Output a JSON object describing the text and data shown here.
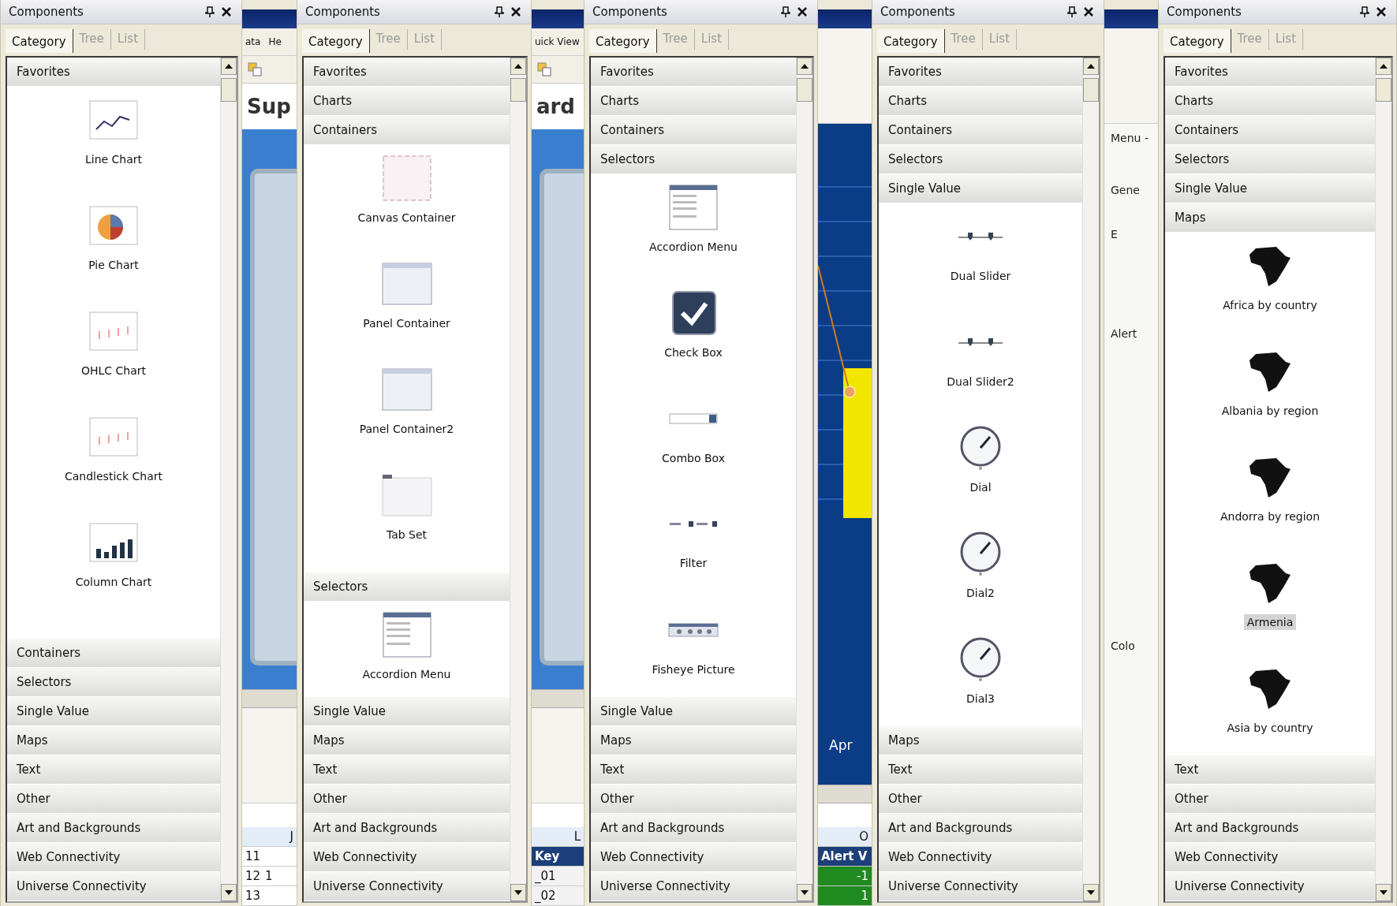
{
  "background_window": {
    "strips": [
      {
        "segments": [
          {
            "kind": "titlebar"
          },
          {
            "kind": "menubar",
            "texts": [
              "ata",
              "He"
            ]
          },
          {
            "kind": "toolbar"
          },
          {
            "kind": "heading",
            "text": "Sup"
          },
          {
            "kind": "canvas"
          },
          {
            "kind": "scrollbar"
          },
          {
            "kind": "blank"
          },
          {
            "kind": "sheet",
            "rows": [
              {
                "kind": "letter",
                "cells": [
                  "J"
                ]
              },
              {
                "kind": "number",
                "cells": [
                  "11"
                ]
              },
              {
                "kind": "number",
                "cells": [
                  "12",
                  "1"
                ]
              },
              {
                "kind": "number",
                "cells": [
                  "13"
                ]
              }
            ]
          }
        ]
      },
      {
        "segments": [
          {
            "kind": "titlebar"
          },
          {
            "kind": "menubar",
            "texts": [
              "uick View"
            ]
          },
          {
            "kind": "toolbar"
          },
          {
            "kind": "heading",
            "text": "ard"
          },
          {
            "kind": "canvas"
          },
          {
            "kind": "scrollbar"
          },
          {
            "kind": "blank"
          },
          {
            "kind": "sheet",
            "rows": [
              {
                "kind": "letter",
                "cells": [
                  "L"
                ]
              },
              {
                "kind": "header",
                "cells": [
                  "Key"
                ]
              },
              {
                "kind": "value",
                "cells": [
                  "_01"
                ]
              },
              {
                "kind": "value",
                "cells": [
                  "_02"
                ]
              }
            ]
          }
        ]
      },
      {
        "segments": [
          {
            "kind": "titlebar"
          },
          {
            "kind": "blank"
          },
          {
            "kind": "chart",
            "text": "Apr"
          },
          {
            "kind": "scrollbar"
          },
          {
            "kind": "sheet",
            "rows": [
              {
                "kind": "letter",
                "cells": [
                  "O"
                ]
              },
              {
                "kind": "header",
                "cells": [
                  "Alert V"
                ]
              },
              {
                "kind": "alert",
                "cells": [
                  "-1"
                ]
              },
              {
                "kind": "alert",
                "cells": [
                  "1"
                ]
              }
            ]
          }
        ]
      },
      {
        "segments": [
          {
            "kind": "titlebar"
          },
          {
            "kind": "blank"
          },
          {
            "kind": "form",
            "texts": [
              "Menu -",
              "Gene",
              "E",
              "Alert",
              "Colo"
            ]
          }
        ]
      }
    ]
  },
  "panels": [
    {
      "title": "Components",
      "tabs": [
        {
          "label": "Category",
          "selected": true
        },
        {
          "label": "Tree",
          "selected": false
        },
        {
          "label": "List",
          "selected": false
        }
      ],
      "sections": [
        {
          "label": "Favorites",
          "items": [
            {
              "label": "Line Chart",
              "kind": "line-chart",
              "selected": false
            },
            {
              "label": "Pie Chart",
              "kind": "pie-chart",
              "selected": false
            },
            {
              "label": "OHLC Chart",
              "kind": "ohlc-chart",
              "selected": false
            },
            {
              "label": "Candlestick Chart",
              "kind": "candlestick-chart",
              "selected": false
            },
            {
              "label": "Column Chart",
              "kind": "column-chart",
              "selected": false
            }
          ]
        },
        {
          "label": "Containers"
        },
        {
          "label": "Selectors"
        },
        {
          "label": "Single Value"
        },
        {
          "label": "Maps"
        },
        {
          "label": "Text"
        },
        {
          "label": "Other"
        },
        {
          "label": "Art and Backgrounds"
        },
        {
          "label": "Web Connectivity"
        },
        {
          "label": "Universe Connectivity"
        }
      ]
    },
    {
      "title": "Components",
      "tabs": [
        {
          "label": "Category",
          "selected": true
        },
        {
          "label": "Tree",
          "selected": false
        },
        {
          "label": "List",
          "selected": false
        }
      ],
      "sections": [
        {
          "label": "Favorites"
        },
        {
          "label": "Charts"
        },
        {
          "label": "Containers",
          "items": [
            {
              "label": "Canvas Container",
              "kind": "canvas-container",
              "selected": false
            },
            {
              "label": "Panel Container",
              "kind": "panel-container",
              "selected": false
            },
            {
              "label": "Panel Container2",
              "kind": "panel-container",
              "selected": false
            },
            {
              "label": "Tab Set",
              "kind": "tab-set",
              "selected": false
            }
          ]
        },
        {
          "label": "Selectors",
          "items": [
            {
              "label": "Accordion Menu",
              "kind": "accordion-menu",
              "selected": false
            }
          ]
        },
        {
          "label": "Single Value"
        },
        {
          "label": "Maps"
        },
        {
          "label": "Text"
        },
        {
          "label": "Other"
        },
        {
          "label": "Art and Backgrounds"
        },
        {
          "label": "Web Connectivity"
        },
        {
          "label": "Universe Connectivity"
        }
      ]
    },
    {
      "title": "Components",
      "tabs": [
        {
          "label": "Category",
          "selected": true
        },
        {
          "label": "Tree",
          "selected": false
        },
        {
          "label": "List",
          "selected": false
        }
      ],
      "sections": [
        {
          "label": "Favorites"
        },
        {
          "label": "Charts"
        },
        {
          "label": "Containers"
        },
        {
          "label": "Selectors",
          "items": [
            {
              "label": "Accordion Menu",
              "kind": "accordion-menu",
              "selected": false
            },
            {
              "label": "Check Box",
              "kind": "check-box",
              "selected": false
            },
            {
              "label": "Combo Box",
              "kind": "combo-box",
              "selected": false
            },
            {
              "label": "Filter",
              "kind": "filter",
              "selected": false
            },
            {
              "label": "Fisheye Picture",
              "kind": "fisheye-picture",
              "selected": false
            }
          ]
        },
        {
          "label": "Single Value"
        },
        {
          "label": "Maps"
        },
        {
          "label": "Text"
        },
        {
          "label": "Other"
        },
        {
          "label": "Art and Backgrounds"
        },
        {
          "label": "Web Connectivity"
        },
        {
          "label": "Universe Connectivity"
        }
      ]
    },
    {
      "title": "Components",
      "tabs": [
        {
          "label": "Category",
          "selected": true
        },
        {
          "label": "Tree",
          "selected": false
        },
        {
          "label": "List",
          "selected": false
        }
      ],
      "sections": [
        {
          "label": "Favorites"
        },
        {
          "label": "Charts"
        },
        {
          "label": "Containers"
        },
        {
          "label": "Selectors"
        },
        {
          "label": "Single Value",
          "items": [
            {
              "label": "Dual Slider",
              "kind": "dual-slider",
              "selected": false
            },
            {
              "label": "Dual Slider2",
              "kind": "dual-slider",
              "selected": false
            },
            {
              "label": "Dial",
              "kind": "dial",
              "selected": false
            },
            {
              "label": "Dial2",
              "kind": "dial",
              "selected": false
            },
            {
              "label": "Dial3",
              "kind": "dial",
              "selected": false
            }
          ]
        },
        {
          "label": "Maps"
        },
        {
          "label": "Text"
        },
        {
          "label": "Other"
        },
        {
          "label": "Art and Backgrounds"
        },
        {
          "label": "Web Connectivity"
        },
        {
          "label": "Universe Connectivity"
        }
      ]
    },
    {
      "title": "Components",
      "tabs": [
        {
          "label": "Category",
          "selected": true
        },
        {
          "label": "Tree",
          "selected": false
        },
        {
          "label": "List",
          "selected": false
        }
      ],
      "sections": [
        {
          "label": "Favorites"
        },
        {
          "label": "Charts"
        },
        {
          "label": "Containers"
        },
        {
          "label": "Selectors"
        },
        {
          "label": "Single Value"
        },
        {
          "label": "Maps",
          "items": [
            {
              "label": "Africa by country",
              "kind": "map",
              "selected": false
            },
            {
              "label": "Albania by region",
              "kind": "map",
              "selected": false
            },
            {
              "label": "Andorra by region",
              "kind": "map",
              "selected": false
            },
            {
              "label": "Armenia",
              "kind": "map",
              "selected": true
            },
            {
              "label": "Asia by country",
              "kind": "map",
              "selected": false
            }
          ]
        },
        {
          "label": "Text"
        },
        {
          "label": "Other"
        },
        {
          "label": "Art and Backgrounds"
        },
        {
          "label": "Web Connectivity"
        },
        {
          "label": "Universe Connectivity"
        }
      ]
    }
  ]
}
